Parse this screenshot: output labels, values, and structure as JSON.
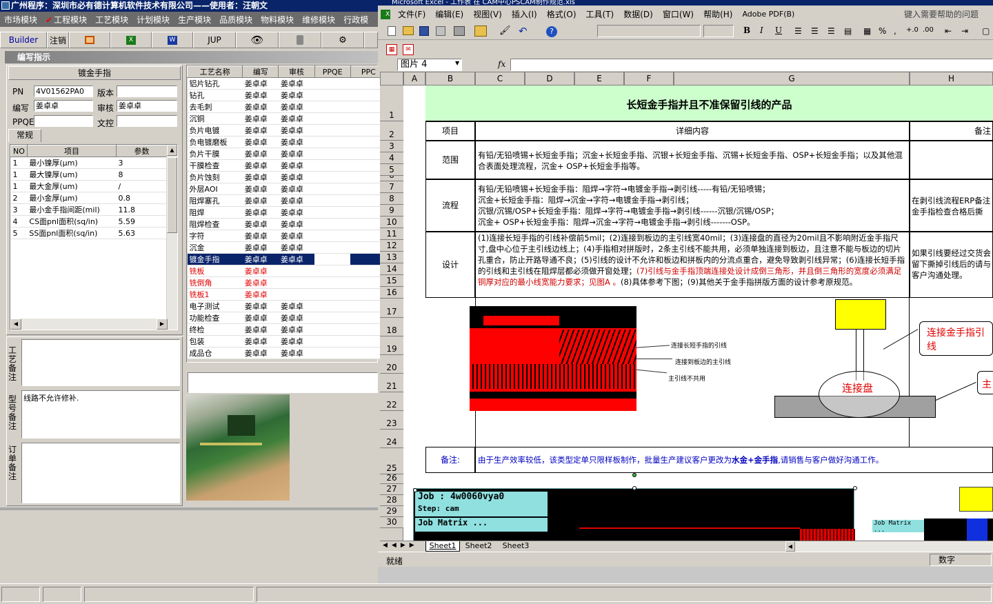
{
  "left_app": {
    "title": "广州程序：深圳市必有德计算机软件技术有限公司——使用者：汪朝文",
    "menu": [
      "市场模块",
      "工程模块",
      "工艺模块",
      "计划模块",
      "生产模块",
      "品质模块",
      "物料模块",
      "维修模块",
      "行政模"
    ],
    "toolbar": {
      "builder": "Builder",
      "logout": "注销",
      "jup": "JUP"
    },
    "panel_title": "编写指示",
    "section_title": "镀金手指",
    "fields": {
      "pn_label": "PN",
      "pn_value": "4V01562PA0",
      "version_label": "版本",
      "writer_label": "编写",
      "writer_value": "姜卓卓",
      "audit_label": "审核",
      "audit_value": "姜卓卓",
      "ppqe_label": "PPQE",
      "doc_label": "文控"
    },
    "tab": "常规",
    "param_headers": [
      "NO",
      "项目",
      "参数"
    ],
    "params": [
      {
        "no": "1",
        "item": "最小镍厚(μm)",
        "value": "3"
      },
      {
        "no": "1",
        "item": "最大镍厚(um)",
        "value": "8"
      },
      {
        "no": "1",
        "item": "最大金厚(um)",
        "value": "/"
      },
      {
        "no": "2",
        "item": "最小金厚(μm)",
        "value": "0.8"
      },
      {
        "no": "3",
        "item": "最小金手指间距(mil)",
        "value": "11.8"
      },
      {
        "no": "4",
        "item": "CS面pnl面积(sq/in)",
        "value": "5.59"
      },
      {
        "no": "5",
        "item": "SS面pnl面积(sq/in)",
        "value": "5.63"
      }
    ],
    "process_headers": [
      "工艺名称",
      "编写",
      "审核",
      "PPQE",
      "PPC"
    ],
    "processes": [
      {
        "name": "铝片钻孔",
        "w": "姜卓卓",
        "a": "姜卓卓"
      },
      {
        "name": "钻孔",
        "w": "姜卓卓",
        "a": "姜卓卓"
      },
      {
        "name": "去毛刺",
        "w": "姜卓卓",
        "a": "姜卓卓"
      },
      {
        "name": "沉铜",
        "w": "姜卓卓",
        "a": "姜卓卓"
      },
      {
        "name": "负片电镀",
        "w": "姜卓卓",
        "a": "姜卓卓"
      },
      {
        "name": "负电镀磨板",
        "w": "姜卓卓",
        "a": "姜卓卓"
      },
      {
        "name": "负片干膜",
        "w": "姜卓卓",
        "a": "姜卓卓"
      },
      {
        "name": "干膜检查",
        "w": "姜卓卓",
        "a": "姜卓卓"
      },
      {
        "name": "负片蚀刻",
        "w": "姜卓卓",
        "a": "姜卓卓"
      },
      {
        "name": "外层AOI",
        "w": "姜卓卓",
        "a": "姜卓卓"
      },
      {
        "name": "阻焊塞孔",
        "w": "姜卓卓",
        "a": "姜卓卓"
      },
      {
        "name": "阻焊",
        "w": "姜卓卓",
        "a": "姜卓卓"
      },
      {
        "name": "阻焊检查",
        "w": "姜卓卓",
        "a": "姜卓卓"
      },
      {
        "name": "字符",
        "w": "姜卓卓",
        "a": "姜卓卓"
      },
      {
        "name": "沉金",
        "w": "姜卓卓",
        "a": "姜卓卓"
      },
      {
        "name": "镀金手指",
        "w": "姜卓卓",
        "a": "姜卓卓",
        "selected": true
      },
      {
        "name": "铣板",
        "w": "姜卓卓",
        "a": "",
        "red": true
      },
      {
        "name": "铣倒角",
        "w": "姜卓卓",
        "a": "",
        "red": true
      },
      {
        "name": "铣板1",
        "w": "姜卓卓",
        "a": "",
        "red": true
      },
      {
        "name": "电子测试",
        "w": "姜卓卓",
        "a": "姜卓卓"
      },
      {
        "name": "功能检查",
        "w": "姜卓卓",
        "a": "姜卓卓"
      },
      {
        "name": "终检",
        "w": "姜卓卓",
        "a": "姜卓卓"
      },
      {
        "name": "包装",
        "w": "姜卓卓",
        "a": "姜卓卓"
      },
      {
        "name": "成品仓",
        "w": "姜卓卓",
        "a": "姜卓卓"
      }
    ],
    "notes": {
      "process_label": "工艺备注",
      "model_label": "型号备注",
      "model_text": "线路不允许修补.",
      "order_label": "订单备注"
    }
  },
  "excel": {
    "title": "Microsoft Excel - 工作表 在 CAM中心PSCAM制作规范.xls",
    "menu": [
      "文件(F)",
      "编辑(E)",
      "视图(V)",
      "插入(I)",
      "格式(O)",
      "工具(T)",
      "数据(D)",
      "窗口(W)",
      "帮助(H)",
      "Adobe PDF(B)"
    ],
    "help_placeholder": "键入需要帮助的问题",
    "name_box": "图片 4",
    "fx": "fx",
    "columns": [
      "A",
      "B",
      "C",
      "D",
      "E",
      "F",
      "G",
      "H"
    ],
    "sheet_title": "长短金手指并且不准保留引线的产品",
    "hdr_item": "项目",
    "hdr_detail": "详细内容",
    "hdr_note": "备注",
    "scope_label": "范围",
    "scope_text": "有铅/无铅喷锡+长短金手指；沉金+长短金手指、沉银+长短金手指、沉锡+长短金手指、OSP+长短金手指；以及其他混合表面处理流程，沉金+ OSP+长短金手指等。",
    "flow_label": "流程",
    "flow_lines": [
      "有铅/无铅喷锡+长短金手指：阻焊→字符→电镀金手指→剥引线-----有铅/无铅喷锡；",
      "沉金+长短金手指：阻焊→沉金→字符→电镀金手指→剥引线；",
      "沉银/沉锡/OSP+长短金手指：阻焊→字符→电镀金手指→剥引线------沉银/沉锡/OSP；",
      "沉金+ OSP+长短金手指：阻焊→沉金→字符→电镀金手指→剥引线-------OSP。"
    ],
    "flow_note": "在剥引线流程ERP备注金手指检查合格后撕",
    "design_label": "设计",
    "design_text": "(1)连接长短手指的引线补偿前5mil；(2)连接到板边的主引线宽40mil；(3)连接盘的直径为20mil且不影响附近金手指尺寸,盘中心位于主引线边线上；(4)手指相对拼版时，2条主引线不能共用，必须单独连接到板边，且注意不能与板边的切片孔重合，防止开路导通不良；(5)引线的设计不允许和板边和拼板内的分流点重合，避免导致剥引线异常；(6)连接长短手指的引线和主引线在阻焊层都必须做开窗处理；",
    "design_text_red": "(7)引线与金手指顶端连接处设计成倒三角形，并且倒三角形的宽度必须满足铜厚对应的最小线宽能力要求；见图A 。",
    "design_text_tail": "(8)具体参考下图；(9)其他关于金手指拼版方面的设计参考原规范。",
    "design_note": "如果引线要经过交货会留下撕掉引线后的请与客户沟通处理。",
    "pcb_labels": [
      "连接长短手指的引线",
      "连接到板边的主引线",
      "主引线不共用"
    ],
    "diagram_labels": {
      "connect_finger": "连接金手指引线",
      "pad": "连接盘",
      "main": "主"
    },
    "remark_label": "备注:",
    "remark_text_a": "由于生产效率较低，该类型定单只限样板制作，批量生产建议客户更改为",
    "remark_text_b": "水金+金手指",
    "remark_text_c": ",请销售与客户做好沟通工作。",
    "cam_text": [
      "Job  :  4w0060vya0",
      "Step:  cam",
      "Job Matrix  ...",
      "Job Matrix ..."
    ],
    "sheets": [
      "Sheet1",
      "Sheet2",
      "Sheet3"
    ],
    "status_left": "就绪",
    "status_right": "数字",
    "rows": [
      "1",
      "2",
      "3",
      "4",
      "5",
      "6",
      "7",
      "8",
      "9",
      "10",
      "11",
      "12",
      "13",
      "14",
      "15",
      "16",
      "17",
      "18",
      "19",
      "20",
      "21",
      "22",
      "23",
      "24",
      "25",
      "26",
      "27",
      "28",
      "29",
      "30"
    ]
  }
}
